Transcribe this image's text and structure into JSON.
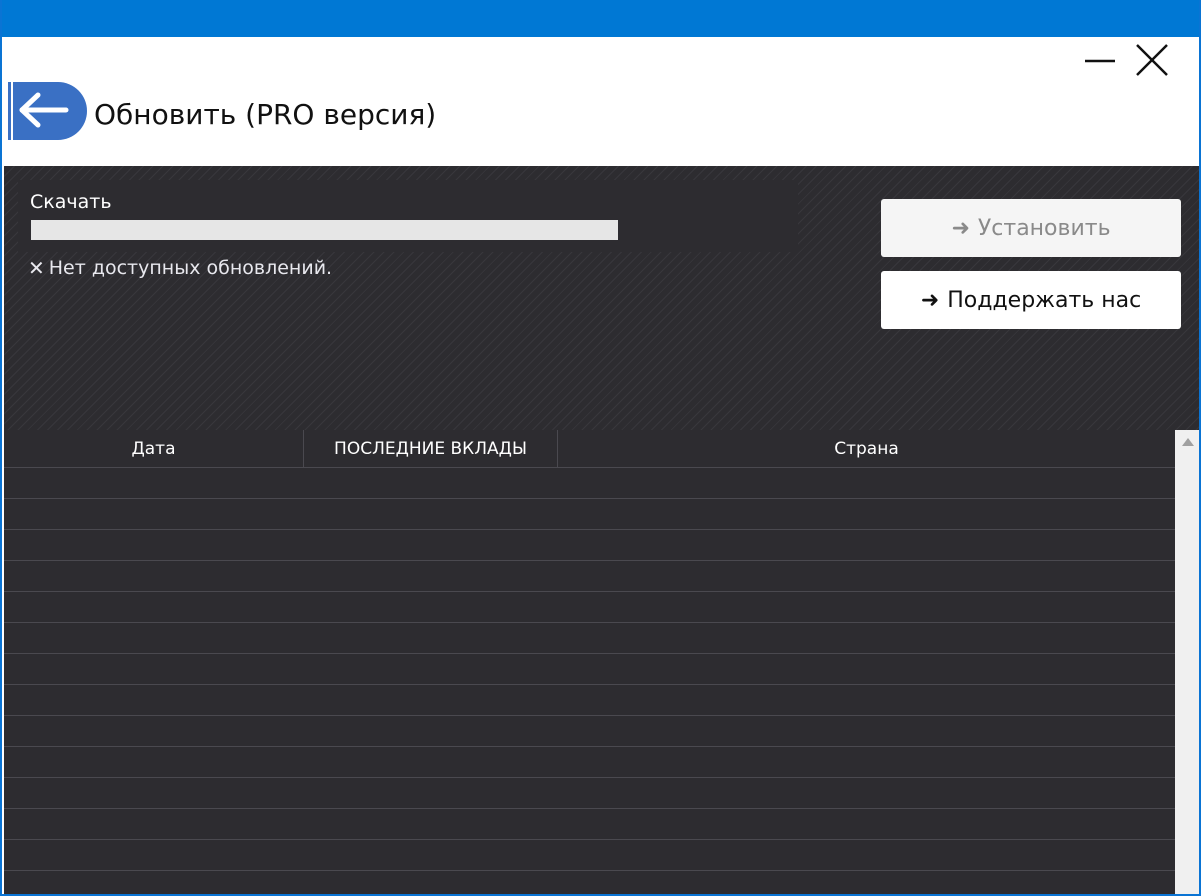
{
  "window": {
    "title": "Обновить (PRO версия)",
    "accent_color": "#0078d4"
  },
  "titlebar": {
    "minimize_icon": "minimize-icon",
    "close_icon": "close-icon",
    "back_icon": "arrow-left-icon"
  },
  "download": {
    "label": "Скачать",
    "progress": 0,
    "status_icon": "x-icon",
    "status_text": "Нет доступных обновлений."
  },
  "actions": {
    "install_label": "Установить",
    "install_enabled": false,
    "support_label": "Поддержать нас",
    "arrow_glyph": "➜"
  },
  "table": {
    "columns": [
      "Дата",
      "ПОСЛЕДНИЕ ВКЛАДЫ",
      "Страна"
    ],
    "rows": []
  },
  "colors": {
    "panel_bg": "#2d2c30",
    "divider": "#4a494f",
    "install_text": "#8a8a8a"
  }
}
